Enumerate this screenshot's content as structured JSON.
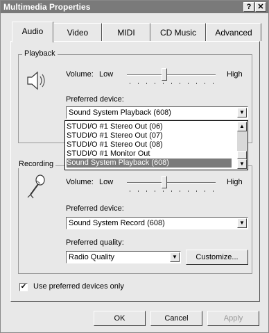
{
  "window": {
    "title": "Multimedia Properties",
    "help_label": "?",
    "close_label": "✕"
  },
  "tabs": [
    {
      "label": "Audio",
      "active": true
    },
    {
      "label": "Video",
      "active": false
    },
    {
      "label": "MIDI",
      "active": false
    },
    {
      "label": "CD Music",
      "active": false
    },
    {
      "label": "Advanced",
      "active": false
    }
  ],
  "playback": {
    "group_label": "Playback",
    "volume_label": "Volume:",
    "volume_low": "Low",
    "volume_high": "High",
    "volume_level": 0.42,
    "device_label": "Preferred device:",
    "device_value": "Sound System Playback (608)",
    "dropdown_items": [
      "STUDI/O #1 Stereo Out (06)",
      "STUDI/O #1 Stereo Out (07)",
      "STUDI/O #1 Stereo Out (08)",
      "STUDI/O #1 Monitor Out",
      "Sound System Playback (608)"
    ],
    "dropdown_selected": "Sound System Playback (608)"
  },
  "recording": {
    "group_label": "Recording",
    "volume_label": "Volume:",
    "volume_low": "Low",
    "volume_high": "High",
    "volume_level": 0.42,
    "device_label": "Preferred device:",
    "device_value": "Sound System Record (608)",
    "quality_label": "Preferred quality:",
    "quality_value": "Radio Quality",
    "customize_label": "Customize..."
  },
  "use_preferred": {
    "label": "Use preferred devices only",
    "checked": true
  },
  "buttons": {
    "ok": "OK",
    "cancel": "Cancel",
    "apply": "Apply"
  },
  "icons": {
    "speaker": "speaker-icon",
    "microphone": "microphone-icon"
  }
}
